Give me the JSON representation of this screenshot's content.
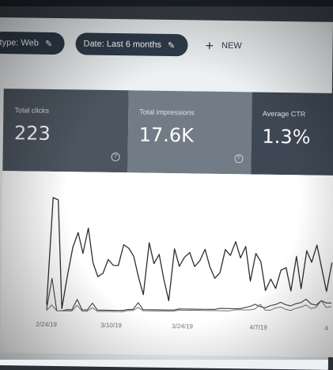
{
  "filters": {
    "type_label": "type: Web",
    "date_label": "Date: Last 6 months",
    "new_label": "NEW"
  },
  "metrics": [
    {
      "label": "Total clicks",
      "value": "223"
    },
    {
      "label": "Total impressions",
      "value": "17.6K"
    },
    {
      "label": "Average CTR",
      "value": "1.3%"
    }
  ],
  "colors": {
    "chip_bg": "#2f3c4a",
    "clicks_tile": "#4c5560",
    "impressions_tile": "#727c86",
    "ctr_tile": "#3e4854",
    "line": "#2b2f33"
  },
  "chart_data": {
    "type": "line",
    "x_tick_labels": [
      "2/24/19",
      "3/10/19",
      "3/24/19",
      "4/7/19",
      "4"
    ],
    "series": [
      {
        "values": [
          5,
          98,
          96,
          2,
          30,
          55,
          68,
          50,
          72,
          42,
          30,
          33,
          45,
          40,
          40,
          58,
          55,
          48,
          30,
          15,
          60,
          42,
          50,
          28,
          10,
          55,
          40,
          48,
          52,
          40,
          45,
          55,
          40,
          30,
          35,
          55,
          50,
          62,
          48,
          58,
          28,
          52,
          45,
          20,
          30,
          22,
          38,
          40,
          20,
          50,
          22,
          55,
          45,
          60,
          40,
          20,
          45
        ]
      },
      {
        "values": [
          1,
          28,
          0,
          0,
          1,
          1,
          10,
          1,
          1,
          7,
          1,
          1,
          1,
          1,
          1,
          1,
          2,
          2,
          8,
          2,
          2,
          2,
          2,
          2,
          2,
          2,
          3,
          3,
          3,
          3,
          3,
          3,
          3,
          3,
          4,
          4,
          4,
          4,
          4,
          5,
          6,
          8,
          6,
          5,
          7,
          8,
          10,
          8,
          7,
          9,
          10,
          13,
          9,
          8,
          12,
          10,
          10
        ]
      },
      {
        "values": [
          0,
          5,
          0,
          0,
          0,
          0,
          5,
          0,
          0,
          3,
          0,
          0,
          0,
          0,
          0,
          0,
          1,
          1,
          4,
          1,
          1,
          1,
          1,
          1,
          1,
          1,
          2,
          2,
          2,
          2,
          2,
          2,
          2,
          2,
          2,
          2,
          2,
          3,
          3,
          3,
          3,
          4,
          8,
          3,
          3,
          5,
          6,
          4,
          3,
          5,
          6,
          8,
          5,
          6,
          12,
          6,
          7
        ]
      }
    ]
  }
}
